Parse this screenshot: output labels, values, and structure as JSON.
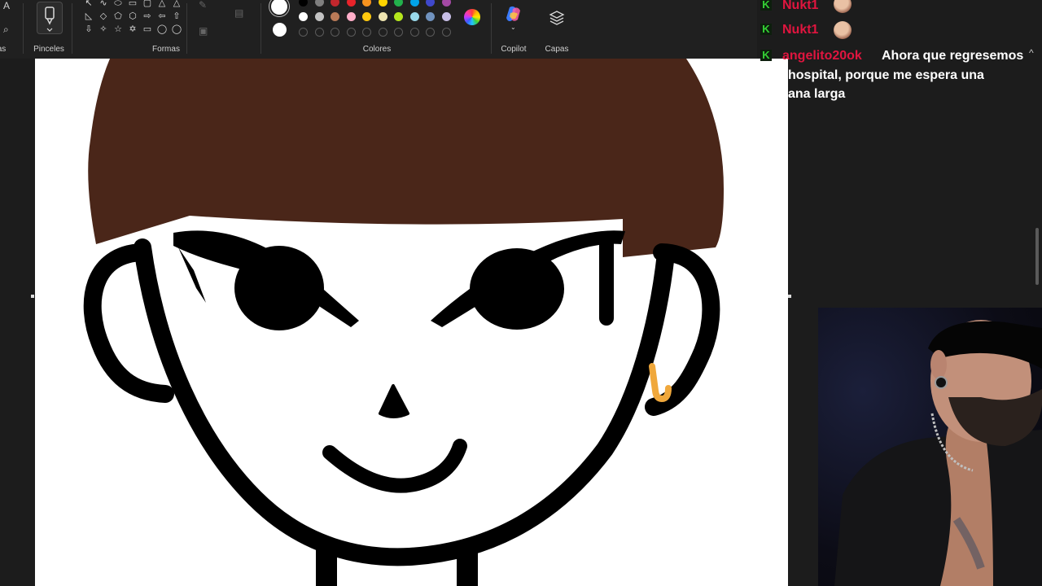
{
  "ribbon": {
    "groups": {
      "brushes": "Pinceles",
      "shapes": "Formas",
      "colors": "Colores",
      "copilot": "Copilot",
      "layers": "Capas"
    },
    "shape_glyphs": [
      "↖",
      "∿",
      "⬭",
      "▭",
      "▢",
      "△",
      "△",
      "◺",
      "◇",
      "⬠",
      "⬡",
      "⇨",
      "⇦",
      "⇧",
      "⇩",
      "✧",
      "☆",
      "✡",
      "▭",
      "◯",
      "◯"
    ],
    "palette_row1": [
      "#000000",
      "#7f7f7f",
      "#c1272d",
      "#e8232a",
      "#f7931e",
      "#ffd400",
      "#22b14c",
      "#00a2e8",
      "#3f48cc",
      "#a349a4"
    ],
    "palette_row2": [
      "#ffffff",
      "#c3c3c3",
      "#b97a57",
      "#ffaec9",
      "#ffc90e",
      "#efe4b0",
      "#b5e61d",
      "#99d9ea",
      "#7092be",
      "#c8bfe7"
    ]
  },
  "chat": {
    "messages": [
      {
        "user": "Nukt1",
        "text": ""
      },
      {
        "user": "Nukt1",
        "text": ""
      },
      {
        "user": "angelito20ok",
        "text": "Ahora que regresemos",
        "cont1": "hospital, porque me espera una",
        "cont2": "ana larga"
      }
    ]
  },
  "drawing": {
    "hair_color": "#4a2619",
    "line_color": "#000000",
    "earring_color": "#f0a83c"
  }
}
